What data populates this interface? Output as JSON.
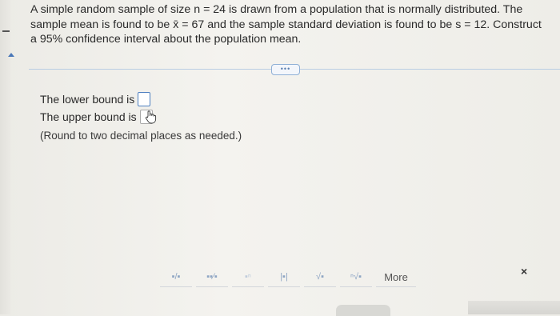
{
  "question": {
    "parts": [
      "A simple random sample of size ",
      "n = 24",
      " is drawn from a population that is normally distributed. The sample mean is found to be ",
      "x̄ = 67",
      " and the sample standard deviation is found to be ",
      "s = 12",
      ". Construct a 95% confidence interval about the population mean."
    ]
  },
  "expand_button": {
    "label": "•••"
  },
  "answers": {
    "lower_label": "The lower bound is",
    "upper_label": "The upper bound is",
    "hint": "(Round to two decimal places as needed.)"
  },
  "toolbar": {
    "buttons": [
      {
        "name": "fraction",
        "glyph": "▪/▪"
      },
      {
        "name": "mixed-number",
        "glyph": "▪▪⁄▪"
      },
      {
        "name": "exponent",
        "glyph": "▪ⁿ"
      },
      {
        "name": "absolute-value",
        "glyph": "|▪|"
      },
      {
        "name": "square-root",
        "glyph": "√▪"
      },
      {
        "name": "nth-root",
        "glyph": "ⁿ√▪"
      }
    ],
    "more_label": "More"
  },
  "close_label": "×",
  "colors": {
    "accent": "#4d7fc0",
    "divider": "#b9cde3"
  }
}
